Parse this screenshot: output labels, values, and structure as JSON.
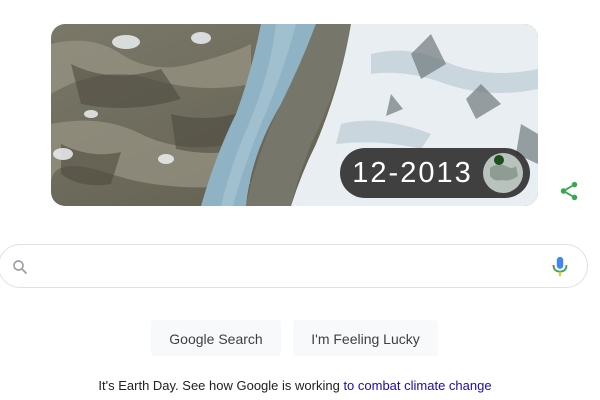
{
  "doodle": {
    "date": "12-2013",
    "alt": "Earth Day doodle satellite timelapse",
    "colors": {
      "pill": "#282828",
      "ice": "#e9eef2",
      "river": "#8fb3c4",
      "rock": "#6b6a5c"
    }
  },
  "share": {
    "icon": "share-icon",
    "color": "#34a853"
  },
  "search": {
    "placeholder": "",
    "value": "",
    "search_icon": "search-icon",
    "mic_icon": "mic-icon"
  },
  "buttons": {
    "search_label": "Google Search",
    "lucky_label": "I'm Feeling Lucky"
  },
  "promo": {
    "text": "It's Earth Day. See how Google is working ",
    "link_text": "to combat climate change"
  }
}
